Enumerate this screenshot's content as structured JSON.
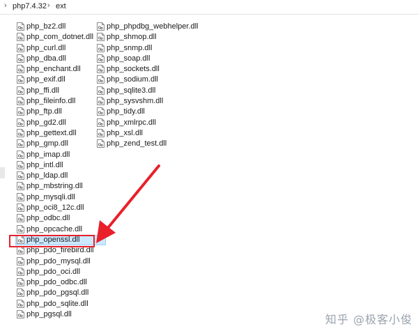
{
  "breadcrumb": {
    "items": [
      "php7.4.32",
      "ext"
    ],
    "separator": "›"
  },
  "file_list": {
    "column_1": [
      "php_bz2.dll",
      "php_com_dotnet.dll",
      "php_curl.dll",
      "php_dba.dll",
      "php_enchant.dll",
      "php_exif.dll",
      "php_ffi.dll",
      "php_fileinfo.dll",
      "php_ftp.dll",
      "php_gd2.dll",
      "php_gettext.dll",
      "php_gmp.dll",
      "php_imap.dll",
      "php_intl.dll",
      "php_ldap.dll",
      "php_mbstring.dll",
      "php_mysqli.dll",
      "php_oci8_12c.dll",
      "php_odbc.dll",
      "php_opcache.dll",
      "php_openssl.dll",
      "php_pdo_firebird.dll",
      "php_pdo_mysql.dll",
      "php_pdo_oci.dll",
      "php_pdo_odbc.dll",
      "php_pdo_pgsql.dll",
      "php_pdo_sqlite.dll",
      "php_pgsql.dll"
    ],
    "column_2": [
      "php_phpdbg_webhelper.dll",
      "php_shmop.dll",
      "php_snmp.dll",
      "php_soap.dll",
      "php_sockets.dll",
      "php_sodium.dll",
      "php_sqlite3.dll",
      "php_sysvshm.dll",
      "php_tidy.dll",
      "php_xmlrpc.dll",
      "php_xsl.dll",
      "php_zend_test.dll"
    ],
    "selected_file": "php_openssl.dll",
    "file_icon": "dll-file-icon"
  },
  "annotation": {
    "color": "#e8202a",
    "target": "php_openssl.dll"
  },
  "watermark": {
    "text": "知乎 @极客小俊"
  },
  "colors": {
    "selection_bg": "#cce8ff",
    "selection_border": "#99d1ff",
    "highlight": "#e8202a"
  }
}
